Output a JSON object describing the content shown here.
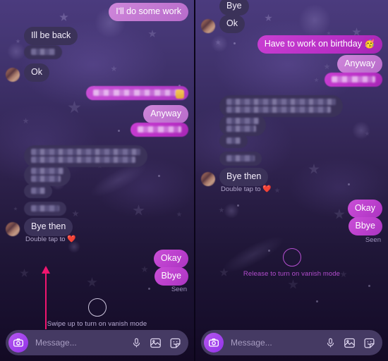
{
  "app": {
    "name": "instagram-direct-chat"
  },
  "panels": [
    {
      "id": "left",
      "state_label": "swipe-up-state",
      "messages": [
        {
          "side": "sent",
          "text": "I'll do some work",
          "style": "light",
          "censored": false
        },
        {
          "side": "received",
          "text": "Ill be back",
          "censored": false,
          "avatar": false
        },
        {
          "side": "received",
          "text": "",
          "censored": true,
          "avatar": false,
          "censor_width": 34,
          "censor_lines": 1
        },
        {
          "side": "received",
          "text": "Ok",
          "censored": false,
          "avatar": true
        },
        {
          "side": "sent",
          "text": "",
          "style": "vivid",
          "censored": true,
          "censor_width": 125,
          "censor_lines": 1,
          "emoji_mark": true
        },
        {
          "side": "sent",
          "text": "Anyway",
          "style": "light",
          "censored": false
        },
        {
          "side": "sent",
          "text": "",
          "style": "magenta",
          "censored": true,
          "censor_width": 62,
          "censor_lines": 1
        },
        {
          "side": "received",
          "text": "",
          "censored": true,
          "avatar": false,
          "censor_width": 155,
          "censor_lines": 2
        },
        {
          "side": "received",
          "text": "",
          "censored": true,
          "avatar": false,
          "censor_width": 46,
          "censor_lines": 2
        },
        {
          "side": "received",
          "text": "",
          "censored": true,
          "avatar": false,
          "censor_width": 20,
          "censor_lines": 1
        },
        {
          "side": "received",
          "text": "",
          "censored": true,
          "avatar": false,
          "censor_width": 40,
          "censor_lines": 1
        },
        {
          "side": "received",
          "text": "Bye then",
          "censored": false,
          "avatar": true
        },
        {
          "side": "sent",
          "text": "Okay",
          "style": "vivid",
          "censored": false
        },
        {
          "side": "sent",
          "text": "Bbye",
          "style": "vivid",
          "censored": false
        }
      ],
      "reaction_hint": "Double tap to",
      "reaction_emoji": "❤️",
      "seen_label": "Seen",
      "vanish_label": "Swipe up to turn on vanish mode",
      "vanish_active": false,
      "swipe_arrow_visible": true,
      "composer": {
        "placeholder": "Message...",
        "camera_icon": "camera-icon",
        "mic_icon": "microphone-icon",
        "gallery_icon": "gallery-icon",
        "sticker_icon": "sticker-icon"
      }
    },
    {
      "id": "right",
      "state_label": "release-state",
      "messages": [
        {
          "side": "received",
          "text": "Bye",
          "censored": false,
          "avatar": false
        },
        {
          "side": "received",
          "text": "Ok",
          "censored": false,
          "avatar": true
        },
        {
          "side": "sent",
          "text": "Have to work on birthday 🥳",
          "style": "magenta",
          "censored": false
        },
        {
          "side": "sent",
          "text": "Anyway",
          "style": "light",
          "censored": false
        },
        {
          "side": "sent",
          "text": "",
          "style": "magenta",
          "censored": true,
          "censor_width": 62,
          "censor_lines": 1
        },
        {
          "side": "received",
          "text": "",
          "censored": true,
          "avatar": false,
          "censor_width": 155,
          "censor_lines": 2
        },
        {
          "side": "received",
          "text": "",
          "censored": true,
          "avatar": false,
          "censor_width": 46,
          "censor_lines": 2
        },
        {
          "side": "received",
          "text": "",
          "censored": true,
          "avatar": false,
          "censor_width": 20,
          "censor_lines": 1
        },
        {
          "side": "received",
          "text": "",
          "censored": true,
          "avatar": false,
          "censor_width": 40,
          "censor_lines": 1
        },
        {
          "side": "received",
          "text": "Bye then",
          "censored": false,
          "avatar": true
        },
        {
          "side": "sent",
          "text": "Okay",
          "style": "vivid",
          "censored": false
        },
        {
          "side": "sent",
          "text": "Bbye",
          "style": "vivid",
          "censored": false
        }
      ],
      "reaction_hint": "Double tap to",
      "reaction_emoji": "❤️",
      "seen_label": "Seen",
      "vanish_label": "Release to turn on vanish mode",
      "vanish_active": true,
      "swipe_arrow_visible": false,
      "composer": {
        "placeholder": "Message...",
        "camera_icon": "camera-icon",
        "mic_icon": "microphone-icon",
        "gallery_icon": "gallery-icon",
        "sticker_icon": "sticker-icon"
      }
    }
  ],
  "left": {
    "m0": "I'll do some work",
    "m1": "Ill be back",
    "m3": "Ok",
    "m5": "Anyway",
    "m11": "Bye then",
    "m12": "Okay",
    "m13": "Bbye",
    "hint": "Double tap to",
    "heart": "❤️",
    "seen": "Seen",
    "vanish": "Swipe up to turn on vanish mode",
    "placeholder": "Message..."
  },
  "right": {
    "m0": "Bye",
    "m1": "Ok",
    "m2": "Have to work on birthday 🥳",
    "m3": "Anyway",
    "m9": "Bye then",
    "m10": "Okay",
    "m11": "Bbye",
    "hint": "Double tap to",
    "heart": "❤️",
    "seen": "Seen",
    "vanish": "Release to turn on vanish mode",
    "placeholder": "Message..."
  },
  "colors": {
    "bg_top": "#4b3b7e",
    "bg_bottom": "#130a24",
    "sent_light": "#c77ad4",
    "sent_vivid": "#bb3fcd",
    "received": "#3b3259",
    "accent_pink": "#f0156f",
    "vanish_active": "#b24dcd",
    "heart_red": "#e8453c",
    "camera_purple": "#9333ea"
  }
}
